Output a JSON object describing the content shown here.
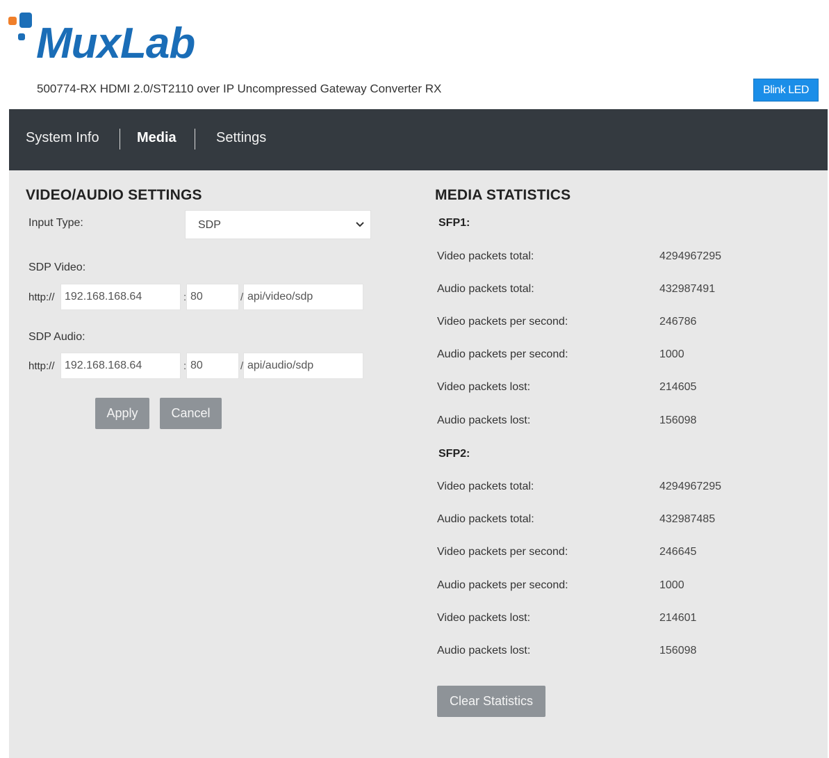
{
  "brand": {
    "logo_text": "MuxLab",
    "subtitle": "500774-RX HDMI 2.0/ST2110 over IP Uncompressed Gateway Converter RX",
    "colors": {
      "logo_blue": "#1a6db7",
      "logo_orange": "#f07f2a",
      "nav_bg": "#343a40",
      "content_bg": "#e8e8e8",
      "blink_blue": "#1b8ee8",
      "button_gray": "#8e9398"
    }
  },
  "header": {
    "blink_label": "Blink LED"
  },
  "nav": {
    "items": [
      {
        "label": "System Info"
      },
      {
        "label": "Media",
        "active": true
      },
      {
        "label": "Settings"
      }
    ]
  },
  "settings": {
    "title": "VIDEO/AUDIO SETTINGS",
    "input_type_label": "Input Type:",
    "input_type_value": "SDP",
    "sdp_video_label": "SDP Video:",
    "sdp_audio_label": "SDP Audio:",
    "video": {
      "prefix": "http://",
      "host": "192.168.168.64",
      "port_sep": ":",
      "port": "80",
      "path_sep": "/",
      "path": "api/video/sdp"
    },
    "audio": {
      "prefix": "http://",
      "host": "192.168.168.64",
      "port_sep": ":",
      "port": "80",
      "path_sep": "/",
      "path": "api/audio/sdp"
    },
    "apply_label": "Apply",
    "cancel_label": "Cancel"
  },
  "stats": {
    "title": "MEDIA STATISTICS",
    "sfp1": {
      "title": "SFP1:",
      "rows": [
        {
          "label": "Video packets total:",
          "value": "4294967295"
        },
        {
          "label": "Audio packets total:",
          "value": "432987491"
        },
        {
          "label": "Video packets per second:",
          "value": "246786"
        },
        {
          "label": "Audio packets per second:",
          "value": "1000"
        },
        {
          "label": "Video packets lost:",
          "value": "214605"
        },
        {
          "label": "Audio packets lost:",
          "value": "156098"
        }
      ]
    },
    "sfp2": {
      "title": "SFP2:",
      "rows": [
        {
          "label": "Video packets total:",
          "value": "4294967295"
        },
        {
          "label": "Audio packets total:",
          "value": "432987485"
        },
        {
          "label": "Video packets per second:",
          "value": "246645"
        },
        {
          "label": "Audio packets per second:",
          "value": "1000"
        },
        {
          "label": "Video packets lost:",
          "value": "214601"
        },
        {
          "label": "Audio packets lost:",
          "value": "156098"
        }
      ]
    },
    "clear_label": "Clear Statistics"
  }
}
